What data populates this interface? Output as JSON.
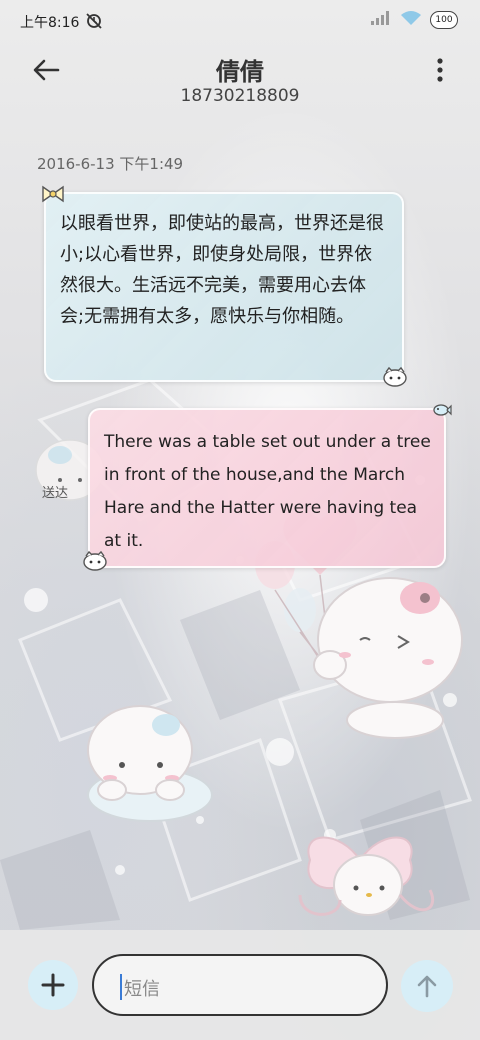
{
  "status_bar": {
    "time": "上午8:16",
    "battery": "100"
  },
  "header": {
    "contact_name": "倩倩",
    "contact_number": "18730218809"
  },
  "conversation": {
    "timestamp": "2016-6-13 下午1:49",
    "messages": [
      {
        "direction": "incoming",
        "text": "以眼看世界，即使站的最高，世界还是很小;以心看世界，即使身处局限，世界依然很大。生活远不完美，需要用心去体会;无需拥有太多，愿快乐与你相随。"
      },
      {
        "direction": "outgoing",
        "text": "There was a table set out under a tree in front of the house,and the March Hare and the Hatter were having tea at it.",
        "status": "送达"
      }
    ]
  },
  "composer": {
    "placeholder": "短信"
  },
  "colors": {
    "incoming_bubble": "#d6e9ee",
    "outgoing_bubble": "#f5d0dc",
    "button_bg": "#d7eef7",
    "caret": "#3a7bd5"
  },
  "icons": {
    "back": "back-arrow-icon",
    "menu": "more-vertical-icon",
    "add": "plus-icon",
    "send": "arrow-up-icon"
  }
}
